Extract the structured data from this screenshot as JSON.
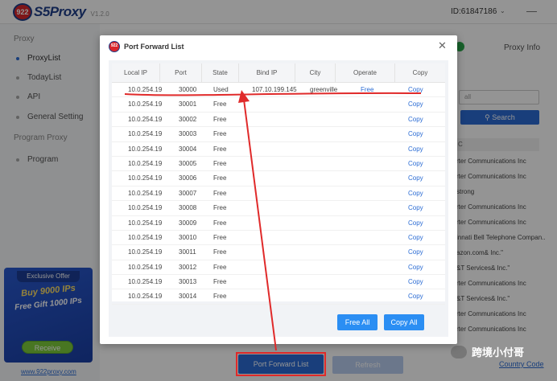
{
  "app": {
    "logo_badge": "922",
    "logo_text": "S5Proxy",
    "version": "V1.2.0",
    "user_id": "ID:61847186",
    "caret": "⌄",
    "minimize": "—"
  },
  "sidebar": {
    "proxy_heading": "Proxy",
    "proxy_items": [
      {
        "label": "ProxyList",
        "active": true
      },
      {
        "label": "TodayList",
        "active": false
      },
      {
        "label": "API",
        "active": false
      },
      {
        "label": "General Setting",
        "active": false
      }
    ],
    "program_heading": "Program Proxy",
    "program_items": [
      {
        "label": "Program",
        "active": false
      }
    ],
    "promo": {
      "top": "Exclusive Offer",
      "line1": "Buy 9000 IPs",
      "line2": "Free Gift 1000 IPs",
      "button": "Receive"
    },
    "promo_url": "www.922proxy.com"
  },
  "background": {
    "proxy_info": "Proxy Info",
    "search_placeholder": "all",
    "search_button": "Search",
    "column_label": "C",
    "rows": [
      "rter Communications Inc",
      "rter Communications Inc",
      "strong",
      "rter Communications Inc",
      "rter Communications Inc",
      "innati Bell Telephone Compan...",
      "azon.com& Inc.\"",
      "&T Services& Inc.\"",
      "rter Communications Inc",
      "&T Services& Inc.\"",
      "rter Communications Inc",
      "rter Communications Inc"
    ],
    "country_code": "Country Code",
    "port_forward_list_button": "Port Forward List",
    "refresh_button": "Refresh",
    "watermark": "跨境小付哥"
  },
  "modal": {
    "logo_badge": "922",
    "title": "Port Forward List",
    "close": "✕",
    "columns": [
      "Local IP",
      "Port",
      "State",
      "Bind IP",
      "City",
      "Operate",
      "Copy"
    ],
    "rows": [
      {
        "local_ip": "10.0.254.19",
        "port": "30000",
        "state": "Used",
        "bind_ip": "107.10.199.145",
        "city": "greenville",
        "operate": "Free",
        "copy": "Copy"
      },
      {
        "local_ip": "10.0.254.19",
        "port": "30001",
        "state": "Free",
        "bind_ip": "",
        "city": "",
        "operate": "",
        "copy": "Copy"
      },
      {
        "local_ip": "10.0.254.19",
        "port": "30002",
        "state": "Free",
        "bind_ip": "",
        "city": "",
        "operate": "",
        "copy": "Copy"
      },
      {
        "local_ip": "10.0.254.19",
        "port": "30003",
        "state": "Free",
        "bind_ip": "",
        "city": "",
        "operate": "",
        "copy": "Copy"
      },
      {
        "local_ip": "10.0.254.19",
        "port": "30004",
        "state": "Free",
        "bind_ip": "",
        "city": "",
        "operate": "",
        "copy": "Copy"
      },
      {
        "local_ip": "10.0.254.19",
        "port": "30005",
        "state": "Free",
        "bind_ip": "",
        "city": "",
        "operate": "",
        "copy": "Copy"
      },
      {
        "local_ip": "10.0.254.19",
        "port": "30006",
        "state": "Free",
        "bind_ip": "",
        "city": "",
        "operate": "",
        "copy": "Copy"
      },
      {
        "local_ip": "10.0.254.19",
        "port": "30007",
        "state": "Free",
        "bind_ip": "",
        "city": "",
        "operate": "",
        "copy": "Copy"
      },
      {
        "local_ip": "10.0.254.19",
        "port": "30008",
        "state": "Free",
        "bind_ip": "",
        "city": "",
        "operate": "",
        "copy": "Copy"
      },
      {
        "local_ip": "10.0.254.19",
        "port": "30009",
        "state": "Free",
        "bind_ip": "",
        "city": "",
        "operate": "",
        "copy": "Copy"
      },
      {
        "local_ip": "10.0.254.19",
        "port": "30010",
        "state": "Free",
        "bind_ip": "",
        "city": "",
        "operate": "",
        "copy": "Copy"
      },
      {
        "local_ip": "10.0.254.19",
        "port": "30011",
        "state": "Free",
        "bind_ip": "",
        "city": "",
        "operate": "",
        "copy": "Copy"
      },
      {
        "local_ip": "10.0.254.19",
        "port": "30012",
        "state": "Free",
        "bind_ip": "",
        "city": "",
        "operate": "",
        "copy": "Copy"
      },
      {
        "local_ip": "10.0.254.19",
        "port": "30013",
        "state": "Free",
        "bind_ip": "",
        "city": "",
        "operate": "",
        "copy": "Copy"
      },
      {
        "local_ip": "10.0.254.19",
        "port": "30014",
        "state": "Free",
        "bind_ip": "",
        "city": "",
        "operate": "",
        "copy": "Copy"
      }
    ],
    "free_all_button": "Free All",
    "copy_all_button": "Copy All"
  },
  "colors": {
    "accent": "#2b6cd4",
    "annotation_red": "#e02a2a",
    "brand_red": "#d9262c"
  }
}
